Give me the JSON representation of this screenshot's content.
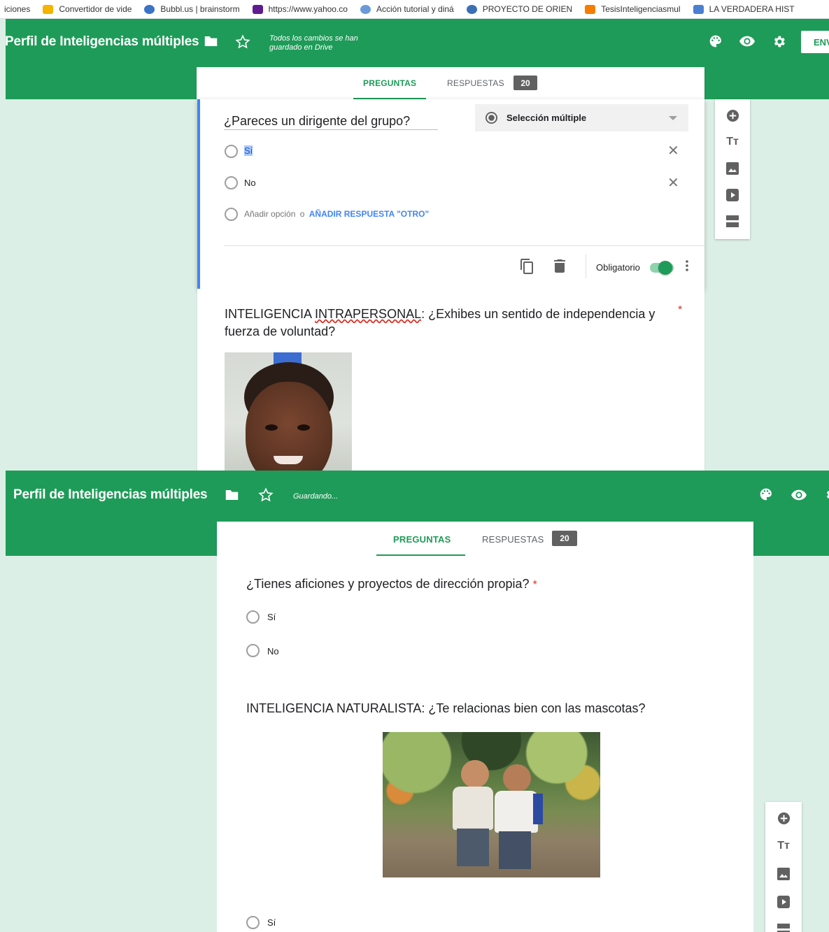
{
  "bookmarks": [
    {
      "label": "iciones",
      "icon": "",
      "color": ""
    },
    {
      "label": "Convertidor de vide",
      "icon": "folder-icon",
      "color": "#f4b400"
    },
    {
      "label": "Bubbl.us | brainstorm",
      "icon": "bubbl-icon",
      "color": "#3b73c5"
    },
    {
      "label": "https://www.yahoo.co",
      "icon": "yahoo-icon",
      "color": "#5f1b8f"
    },
    {
      "label": "Acción tutorial y diná",
      "icon": "wiki-icon",
      "color": "#6a9bd8"
    },
    {
      "label": "PROYECTO DE ORIEN",
      "icon": "web-icon",
      "color": "#3d6fb5"
    },
    {
      "label": "TesisInteligenciasmul",
      "icon": "blogger-icon",
      "color": "#f57d00"
    },
    {
      "label": "LA VERDADERA HIST",
      "icon": "bookmark-icon",
      "color": "#4a7fd2"
    }
  ],
  "shot1": {
    "app_title": "Perfil de Inteligencias múltiples",
    "save_status_line1": "Todos los cambios se han",
    "save_status_line2": "guardado en Drive",
    "send_label": "ENV",
    "tabs": {
      "preguntas": "PREGUNTAS",
      "respuestas": "RESPUESTAS",
      "count": "20"
    },
    "active_question": {
      "title": "¿Pareces un dirigente del grupo?",
      "type_label": "Selección múltiple",
      "options": [
        "Sí",
        "No"
      ],
      "add_option": "Añadir opción",
      "or_text": "o",
      "add_other": "AÑADIR RESPUESTA \"OTRO\"",
      "required_label": "Obligatorio",
      "required": true
    },
    "next_question": {
      "title_prefix": "INTELIGENCIA ",
      "title_misspelled": "INTRAPERSONAL",
      "title_rest": ": ¿Exhibes un sentido de independencia y",
      "title_line2": "fuerza de voluntad?",
      "required_mark": "*"
    }
  },
  "shot2": {
    "app_title": "Perfil de Inteligencias múltiples",
    "save_status": "Guardando...",
    "tabs": {
      "preguntas": "PREGUNTAS",
      "respuestas": "RESPUESTAS",
      "count": "20"
    },
    "question1": {
      "title": "¿Tienes aficiones y proyectos de dirección propia?",
      "required_mark": "*",
      "options": [
        "Sí",
        "No"
      ]
    },
    "question2": {
      "title": "INTELIGENCIA NATURALISTA: ¿Te relacionas bien con las mascotas?",
      "options": [
        "Sí"
      ]
    }
  },
  "colors": {
    "brand_green": "#1e9b58",
    "background": "#dcefe6",
    "focus_blue": "#4285f4",
    "required_red": "#d93025"
  }
}
